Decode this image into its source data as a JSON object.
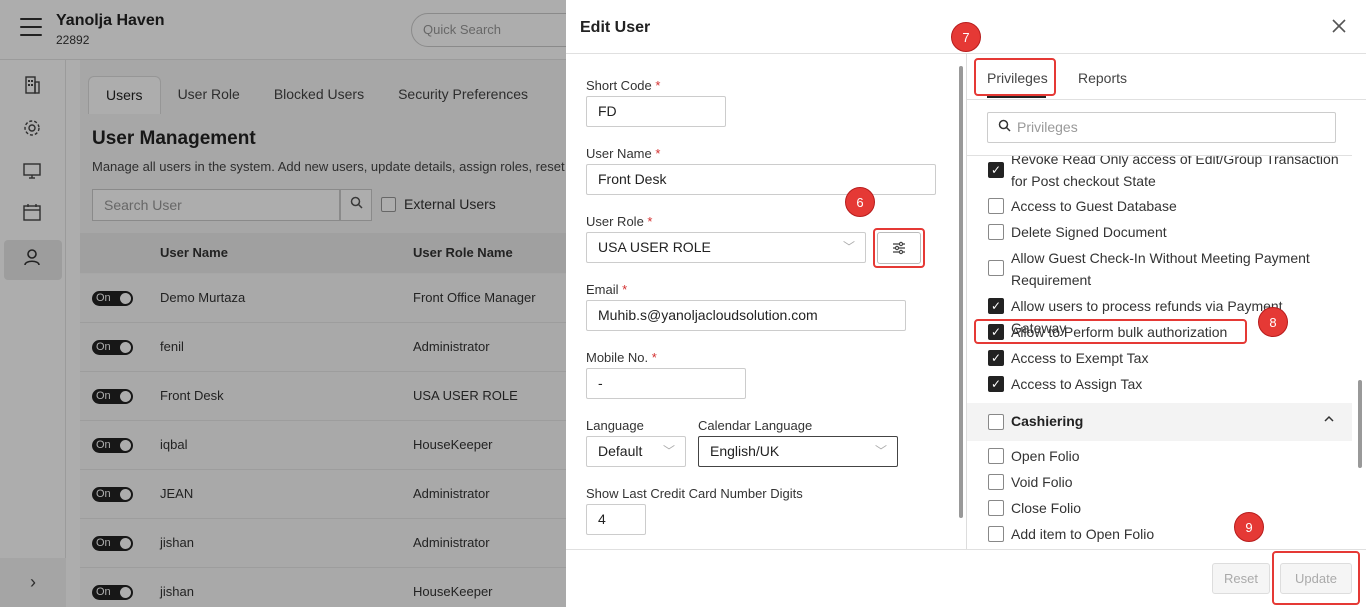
{
  "app": {
    "hotel_name": "Yanolja Haven",
    "hotel_code": "22892",
    "quick_search_placeholder": "Quick Search"
  },
  "nav": {
    "icons": [
      "building-icon",
      "gear-icon",
      "monitor-icon",
      "calendar-icon",
      "user-icon"
    ],
    "expand_icon": "chevron-right-icon"
  },
  "background": {
    "tabs": [
      "Users",
      "User Role",
      "Blocked Users",
      "Security Preferences"
    ],
    "title": "User Management",
    "description": "Manage all users in the system. Add new users, update details, assign roles, reset p",
    "search_placeholder": "Search User",
    "external_users_label": "External Users",
    "columns": [
      "User Name",
      "User Role Name"
    ],
    "rows": [
      {
        "status": "On",
        "name": "Demo Murtaza",
        "role": "Front Office Manager"
      },
      {
        "status": "On",
        "name": "fenil",
        "role": "Administrator"
      },
      {
        "status": "On",
        "name": "Front Desk",
        "role": "USA USER ROLE"
      },
      {
        "status": "On",
        "name": "iqbal",
        "role": "HouseKeeper"
      },
      {
        "status": "On",
        "name": "JEAN",
        "role": "Administrator"
      },
      {
        "status": "On",
        "name": "jishan",
        "role": "Administrator"
      },
      {
        "status": "On",
        "name": "jishan",
        "role": "HouseKeeper"
      }
    ]
  },
  "drawer": {
    "title": "Edit User",
    "close_icon": "close-icon",
    "form": {
      "short_code_label": "Short Code",
      "short_code_value": "FD",
      "user_name_label": "User Name",
      "user_name_value": "Front Desk",
      "user_role_label": "User Role",
      "user_role_value": "USA USER ROLE",
      "email_label": "Email",
      "email_value": "Muhib.s@yanoljacloudsolution.com",
      "mobile_label": "Mobile No.",
      "mobile_value": "-",
      "language_label": "Language",
      "language_value": "Default",
      "calendar_language_label": "Calendar Language",
      "calendar_language_value": "English/UK",
      "cc_digits_label": "Show Last Credit Card Number Digits",
      "cc_digits_value": "4",
      "required_mark": "*"
    },
    "right_tabs": [
      "Privileges",
      "Reports"
    ],
    "privileges_search_placeholder": "Privileges",
    "privileges": [
      {
        "label": "Revoke Read Only access of Edit/Group Transaction for Post checkout State",
        "checked": true
      },
      {
        "label": "Access to Guest Database",
        "checked": false
      },
      {
        "label": "Delete Signed Document",
        "checked": false
      },
      {
        "label": "Allow Guest Check-In Without Meeting Payment Requirement",
        "checked": false
      },
      {
        "label": "Allow users to process refunds via Payment Gateway",
        "checked": true
      },
      {
        "label": "Allow to Perform bulk authorization",
        "checked": true
      },
      {
        "label": "Access to Exempt Tax",
        "checked": true
      },
      {
        "label": "Access to Assign Tax",
        "checked": true
      }
    ],
    "cashiering": {
      "title": "Cashiering",
      "checked": false,
      "items": [
        {
          "label": "Open Folio",
          "checked": false
        },
        {
          "label": "Void Folio",
          "checked": false
        },
        {
          "label": "Close Folio",
          "checked": false
        },
        {
          "label": "Add item to Open Folio",
          "checked": false
        }
      ]
    },
    "buttons": {
      "reset": "Reset",
      "update": "Update"
    }
  },
  "markers": [
    "6",
    "7",
    "8",
    "9"
  ],
  "colors": {
    "annotation_red": "#e53935",
    "toggle_on": "#222222"
  }
}
